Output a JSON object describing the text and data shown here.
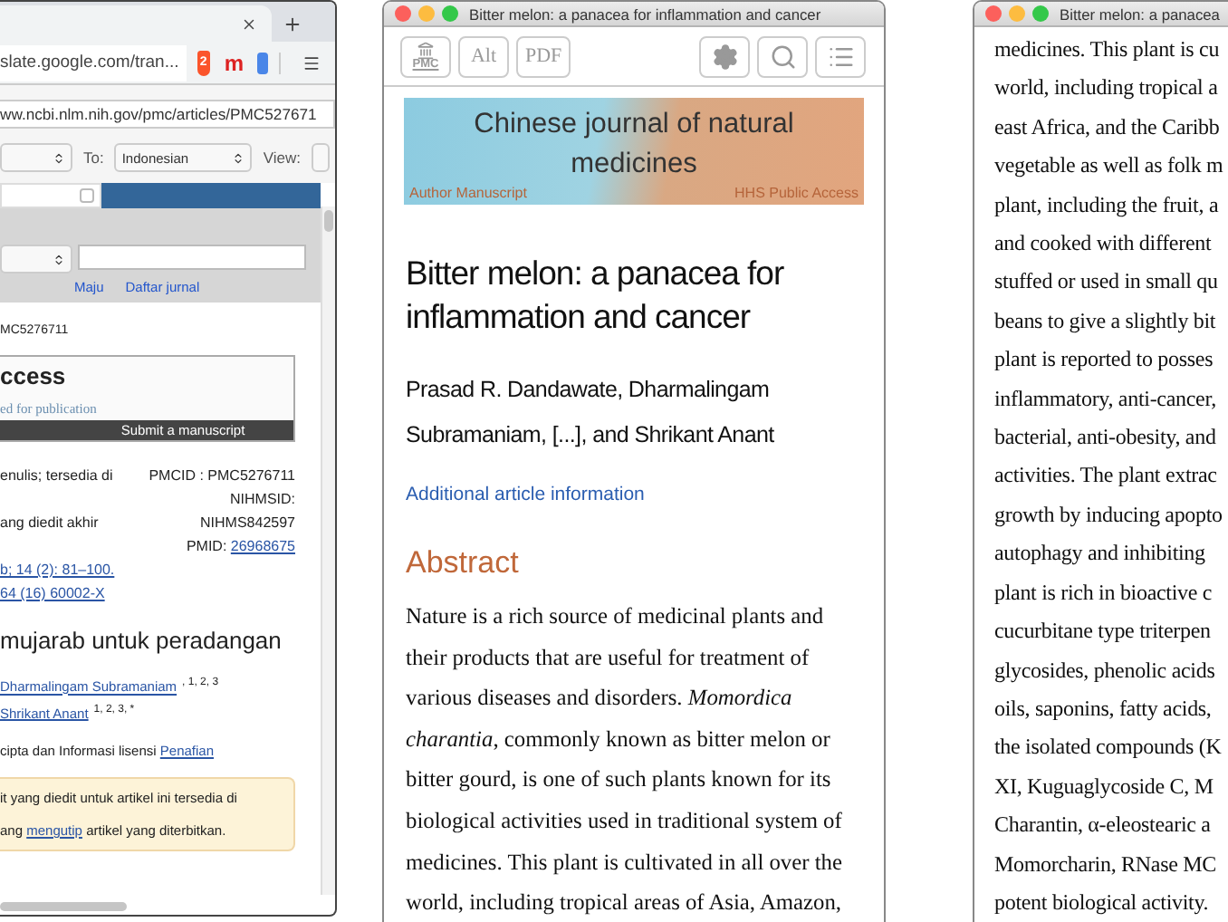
{
  "left_window": {
    "address": "slate.google.com/tran...",
    "extension_badge": "2",
    "extension_letter": "m",
    "translate_url": "ww.ncbi.nlm.nih.gov/pmc/articles/PMC527671",
    "to_label": "To:",
    "to_language": "Indonesian",
    "view_label": "View:",
    "checkbox": {
      "checked": false
    },
    "nav_links": [
      "Maju",
      "Daftar jurnal"
    ],
    "article_id": "MC5276711",
    "access_box": {
      "heading": "ccess",
      "subtitle": "ed for publication",
      "button": "Submit a manuscript"
    },
    "meta_rows": [
      {
        "left": "enulis; tersedia di",
        "right": "PMCID : PMC5276711"
      },
      {
        "left": "",
        "right": "NIHMSID:"
      },
      {
        "left": "ang diedit akhir",
        "right": "NIHMS842597"
      }
    ],
    "pmid_label": "PMID:",
    "pmid": "26968675",
    "citation_links": [
      "b; 14 (2): 81–100.",
      "64 (16) 60002-X"
    ],
    "title": "mujarab untuk peradangan",
    "authors": [
      {
        "name": "Dharmalingam Subramaniam",
        "sup": ", 1, 2, 3"
      },
      {
        "name": "Shrikant Anant",
        "sup": "1, 2, 3, *"
      }
    ],
    "license_text": "cipta dan Informasi lisensi",
    "license_link": "Penafian",
    "notice": {
      "line_1": "it yang diedit untuk artikel ini tersedia di",
      "line_2_prefix": "ang",
      "line_2_link": "mengutip",
      "line_2_suffix": "artikel yang diterbitkan."
    }
  },
  "middle_window": {
    "title": "Bitter melon: a panacea for inflammation and cancer",
    "toolbar": [
      {
        "kind": "pmc",
        "label": "PMC"
      },
      {
        "kind": "text",
        "label": "Alt"
      },
      {
        "kind": "text",
        "label": "PDF"
      },
      {
        "kind": "gear"
      },
      {
        "kind": "search"
      },
      {
        "kind": "list"
      }
    ],
    "banner": {
      "journal": "Chinese journal of natural medicines",
      "left": "Author Manuscript",
      "right": "HHS Public Access"
    },
    "article_title": "Bitter melon: a panacea for inflammation and cancer",
    "authors": "Prasad R. Dandawate, Dharmalingam Subramaniam, [...], and Shrikant Anant",
    "info_link": "Additional article information",
    "abstract_heading": "Abstract",
    "abstract_lines": [
      "Nature is a rich source of medicinal plants and",
      "their products that are useful for treatment of",
      "various diseases and disorders. *Momordica*",
      "*charantia*, commonly known as bitter melon or",
      "bitter gourd, is one of such plants known for its",
      "biological activities used in traditional system of",
      "medicines. This plant is cultivated in all over the",
      "world, including tropical areas of Asia, Amazon,"
    ]
  },
  "right_window": {
    "title": "Bitter melon: a panacea",
    "lines": [
      "medicines. This plant is cu",
      "world, including tropical a",
      "east Africa, and the Caribb",
      "vegetable as well as folk m",
      "plant, including the fruit, a",
      "and cooked with different",
      "stuffed or used in small qu",
      "beans to give a slightly bit",
      "plant is reported to posses",
      "inflammatory, anti-cancer,",
      "bacterial, anti-obesity, and",
      "activities. The plant extrac",
      "growth by inducing apopto",
      "autophagy and inhibiting",
      "plant is rich in bioactive c",
      "cucurbitane type triterpen",
      "glycosides, phenolic acids",
      "oils, saponins, fatty acids,",
      "the isolated compounds (K",
      "XI, Kuguaglycoside C, M",
      "Charantin, α-eleostearic a",
      "Momorcharin, RNase MC",
      "potent biological activity."
    ]
  }
}
